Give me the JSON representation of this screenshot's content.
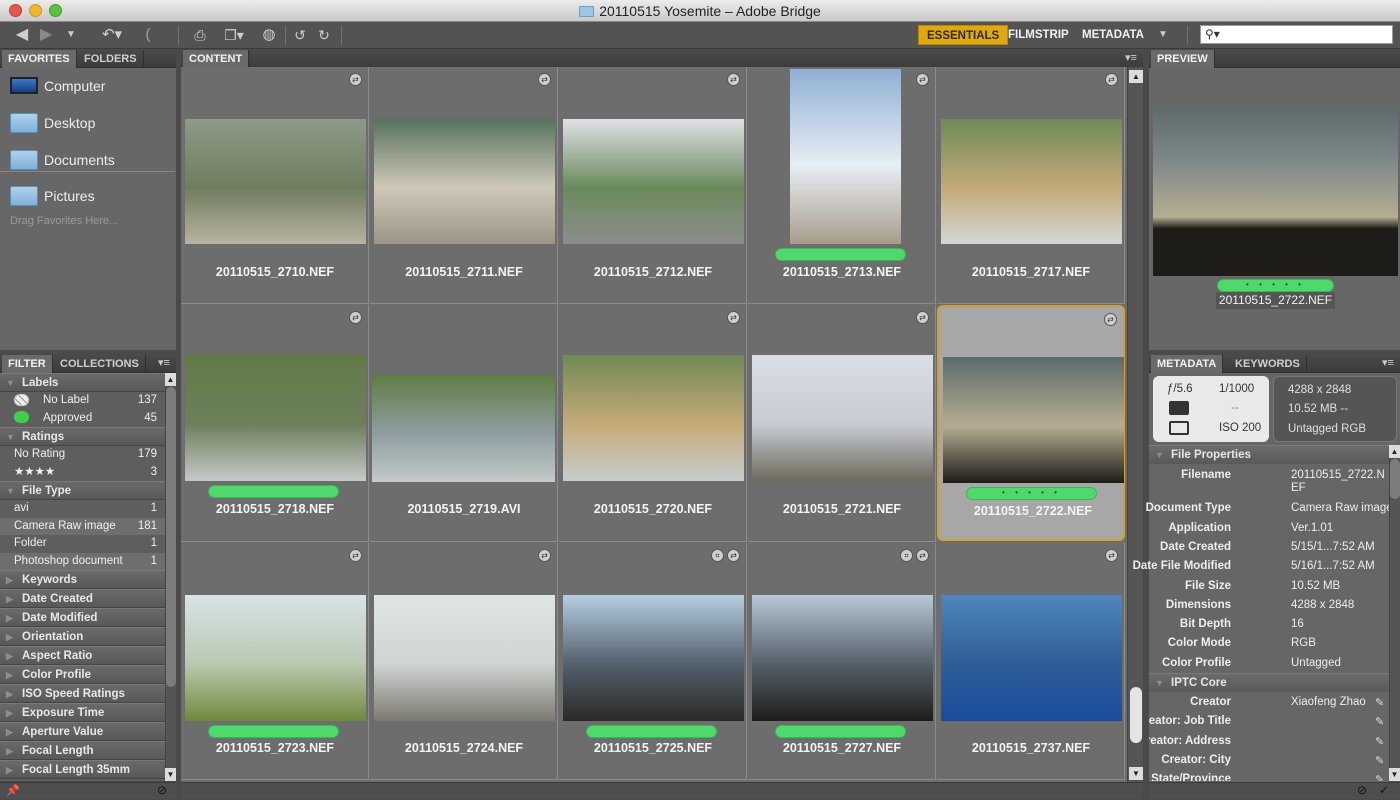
{
  "window": {
    "title": "20110515 Yosemite – Adobe Bridge"
  },
  "toolbar": {
    "back": "back-arrow-icon",
    "forward": "forward-arrow-icon",
    "recent": "recent-folders-dropdown",
    "boomerang": "return-to-previous-app-icon",
    "get_photos": "get-photos-from-camera-icon",
    "refine": "refine-icon",
    "open_camera_raw": "open-in-camera-raw-icon",
    "rotate_left": "rotate-left-icon",
    "rotate_right": "rotate-right-icon",
    "workspaces": [
      {
        "label": "ESSENTIALS",
        "active": true
      },
      {
        "label": "FILMSTRIP",
        "active": false
      },
      {
        "label": "METADATA",
        "active": false
      }
    ],
    "workspace_more": "▼",
    "search_placeholder": "⚲▾"
  },
  "left_top": {
    "tabs": [
      {
        "label": "FAVORITES",
        "active": true
      },
      {
        "label": "FOLDERS",
        "active": false
      }
    ],
    "items": [
      {
        "label": "Computer",
        "icon": "laptop-icon"
      },
      {
        "label": "Desktop",
        "icon": "folder-icon"
      },
      {
        "label": "Documents",
        "icon": "folder-icon"
      },
      {
        "label": "Pictures",
        "icon": "folder-icon"
      }
    ],
    "hint": "Drag Favorites Here..."
  },
  "filter": {
    "tabs": [
      {
        "label": "FILTER",
        "active": true
      },
      {
        "label": "COLLECTIONS",
        "active": false
      }
    ],
    "groups": [
      {
        "title": "Labels",
        "expanded": true,
        "rows": [
          {
            "label": "No Label",
            "count": "137",
            "swatch": "none"
          },
          {
            "label": "Approved",
            "count": "45",
            "swatch": "#3fcf4a"
          }
        ]
      },
      {
        "title": "Ratings",
        "expanded": true,
        "rows": [
          {
            "label": "No Rating",
            "count": "179"
          },
          {
            "label": "★★★★",
            "count": "3"
          }
        ]
      },
      {
        "title": "File Type",
        "expanded": true,
        "rows": [
          {
            "label": "avi",
            "count": "1"
          },
          {
            "label": "Camera Raw image",
            "count": "181"
          },
          {
            "label": "Folder",
            "count": "1"
          },
          {
            "label": "Photoshop document",
            "count": "1"
          }
        ]
      }
    ],
    "collapsed": [
      "Keywords",
      "Date Created",
      "Date Modified",
      "Orientation",
      "Aspect Ratio",
      "Color Profile",
      "ISO Speed Ratings",
      "Exposure Time",
      "Aperture Value",
      "Focal Length",
      "Focal Length 35mm"
    ]
  },
  "content": {
    "tab": "CONTENT",
    "items": [
      {
        "name": "20110515_2710.NEF",
        "label": false,
        "rating": "",
        "selected": false,
        "crop": false,
        "badge": true,
        "palette": [
          "#8d9a86",
          "#6f7d5f",
          "#b9b3a3"
        ]
      },
      {
        "name": "20110515_2711.NEF",
        "label": false,
        "rating": "",
        "selected": false,
        "crop": false,
        "badge": true,
        "palette": [
          "#56725d",
          "#cfc8b8",
          "#9c9585"
        ]
      },
      {
        "name": "20110515_2712.NEF",
        "label": false,
        "rating": "",
        "selected": false,
        "crop": false,
        "badge": true,
        "palette": [
          "#dfe2e6",
          "#6a8a5c",
          "#8d8d8d"
        ]
      },
      {
        "name": "20110515_2713.NEF",
        "label": true,
        "rating": "",
        "selected": false,
        "crop": false,
        "badge": true,
        "portrait": true,
        "palette": [
          "#8fb0d4",
          "#e8eef4",
          "#a79c8c"
        ]
      },
      {
        "name": "20110515_2717.NEF",
        "label": false,
        "rating": "",
        "selected": false,
        "crop": false,
        "badge": true,
        "palette": [
          "#6e8a58",
          "#c4aa78",
          "#d2d6d8"
        ]
      },
      {
        "name": "20110515_2718.NEF",
        "label": true,
        "rating": "",
        "selected": false,
        "crop": false,
        "badge": true,
        "palette": [
          "#5f7c45",
          "#6d7f5c",
          "#c6c9c9"
        ]
      },
      {
        "name": "20110515_2719.AVI",
        "label": false,
        "rating": "",
        "selected": false,
        "crop": false,
        "badge": false,
        "short": true,
        "palette": [
          "#5f7c45",
          "#8e9ea0",
          "#c6c9c9"
        ]
      },
      {
        "name": "20110515_2720.NEF",
        "label": false,
        "rating": "",
        "selected": false,
        "crop": false,
        "badge": true,
        "palette": [
          "#6f8a55",
          "#c5aa78",
          "#c8ccce"
        ]
      },
      {
        "name": "20110515_2721.NEF",
        "label": false,
        "rating": "",
        "selected": false,
        "crop": false,
        "badge": true,
        "palette": [
          "#d9dfe4",
          "#c6ccd2",
          "#6c6a5c"
        ]
      },
      {
        "name": "20110515_2722.NEF",
        "label": true,
        "rating": "• • • • •",
        "selected": true,
        "crop": false,
        "badge": true,
        "palette": [
          "#5d6a6c",
          "#b5ad92",
          "#1d1c18"
        ]
      },
      {
        "name": "20110515_2723.NEF",
        "label": true,
        "rating": "",
        "selected": false,
        "crop": false,
        "badge": true,
        "palette": [
          "#d8e4e6",
          "#b9c8b0",
          "#6e8a3c"
        ]
      },
      {
        "name": "20110515_2724.NEF",
        "label": false,
        "rating": "",
        "selected": false,
        "crop": false,
        "badge": true,
        "palette": [
          "#e1e5e6",
          "#cfd4d2",
          "#7b7a70"
        ]
      },
      {
        "name": "20110515_2725.NEF",
        "label": true,
        "rating": "",
        "selected": false,
        "crop": true,
        "badge": true,
        "palette": [
          "#b6cfe0",
          "#53606e",
          "#2b2a24"
        ]
      },
      {
        "name": "20110515_2727.NEF",
        "label": true,
        "rating": "",
        "selected": false,
        "crop": true,
        "badge": true,
        "palette": [
          "#b8cad6",
          "#55606a",
          "#1e1d1a"
        ]
      },
      {
        "name": "20110515_2737.NEF",
        "label": false,
        "rating": "",
        "selected": false,
        "crop": false,
        "badge": true,
        "palette": [
          "#4f86bd",
          "#2f5d97",
          "#1a4c9c"
        ]
      }
    ]
  },
  "preview": {
    "tab": "PREVIEW",
    "filename": "20110515_2722.NEF",
    "rating": "• • • • •"
  },
  "metadata": {
    "tabs": [
      {
        "label": "METADATA",
        "active": true
      },
      {
        "label": "KEYWORDS",
        "active": false
      }
    ],
    "placard": {
      "aperture": "ƒ/5.6",
      "shutter": "1/1000",
      "metering": "--",
      "iso": "ISO 200",
      "dimensions": "4288 x 2848",
      "size": "10.52 MB --",
      "profile": "Untagged RGB"
    },
    "file_properties_title": "File Properties",
    "file_properties": [
      {
        "key": "Filename",
        "value": "20110515_2722.NEF"
      },
      {
        "key": "Document Type",
        "value": "Camera Raw image"
      },
      {
        "key": "Application",
        "value": "Ver.1.01"
      },
      {
        "key": "Date Created",
        "value": "5/15/1...7:52 AM"
      },
      {
        "key": "Date File Modified",
        "value": "5/16/1...7:52 AM"
      },
      {
        "key": "File Size",
        "value": "10.52 MB"
      },
      {
        "key": "Dimensions",
        "value": "4288 x 2848"
      },
      {
        "key": "Bit Depth",
        "value": "16"
      },
      {
        "key": "Color Mode",
        "value": "RGB"
      },
      {
        "key": "Color Profile",
        "value": "Untagged"
      }
    ],
    "iptc_title": "IPTC Core",
    "iptc": [
      {
        "key": "Creator",
        "value": "Xiaofeng Zhao"
      },
      {
        "key": "Creator: Job Title",
        "value": ""
      },
      {
        "key": "Creator: Address",
        "value": ""
      },
      {
        "key": "Creator: City",
        "value": ""
      },
      {
        "key": "Creator: State/Province",
        "value": ""
      }
    ]
  },
  "colors": {
    "accent": "#e2a90f",
    "approved": "#4fd96d",
    "selection": "#d1a22b"
  }
}
